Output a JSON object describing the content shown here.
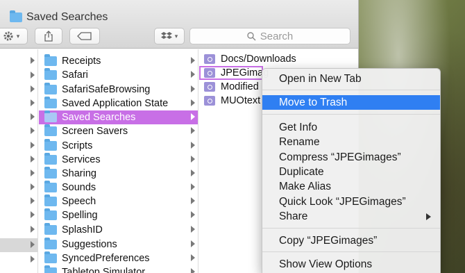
{
  "window": {
    "title": "Saved Searches"
  },
  "toolbar": {
    "search_placeholder": "Search"
  },
  "column2": {
    "items": [
      {
        "label": "Receipts"
      },
      {
        "label": "Safari"
      },
      {
        "label": "SafariSafeBrowsing"
      },
      {
        "label": "Saved Application State"
      },
      {
        "label": "Saved Searches",
        "selected": true
      },
      {
        "label": "Screen Savers"
      },
      {
        "label": "Scripts"
      },
      {
        "label": "Services"
      },
      {
        "label": "Sharing"
      },
      {
        "label": "Sounds"
      },
      {
        "label": "Speech"
      },
      {
        "label": "Spelling"
      },
      {
        "label": "SplashID"
      },
      {
        "label": "Suggestions"
      },
      {
        "label": "SyncedPreferences"
      },
      {
        "label": "Tabletop Simulator"
      }
    ]
  },
  "column3": {
    "items": [
      {
        "label": "Docs/Downloads"
      },
      {
        "label": "JPEGimag"
      },
      {
        "label": "Modified"
      },
      {
        "label": "MUOtext"
      }
    ]
  },
  "context_menu": {
    "open_new_tab": "Open in New Tab",
    "move_to_trash": "Move to Trash",
    "get_info": "Get Info",
    "rename": "Rename",
    "compress": "Compress “JPEGimages”",
    "duplicate": "Duplicate",
    "make_alias": "Make Alias",
    "quick_look": "Quick Look “JPEGimages”",
    "share": "Share",
    "copy": "Copy “JPEGimages”",
    "show_view_options": "Show View Options"
  },
  "colors": {
    "selection": "#c86fe6",
    "menu_highlight": "#2f7ff2",
    "folder": "#6eb8ef",
    "smart_folder": "#9c91d8"
  }
}
